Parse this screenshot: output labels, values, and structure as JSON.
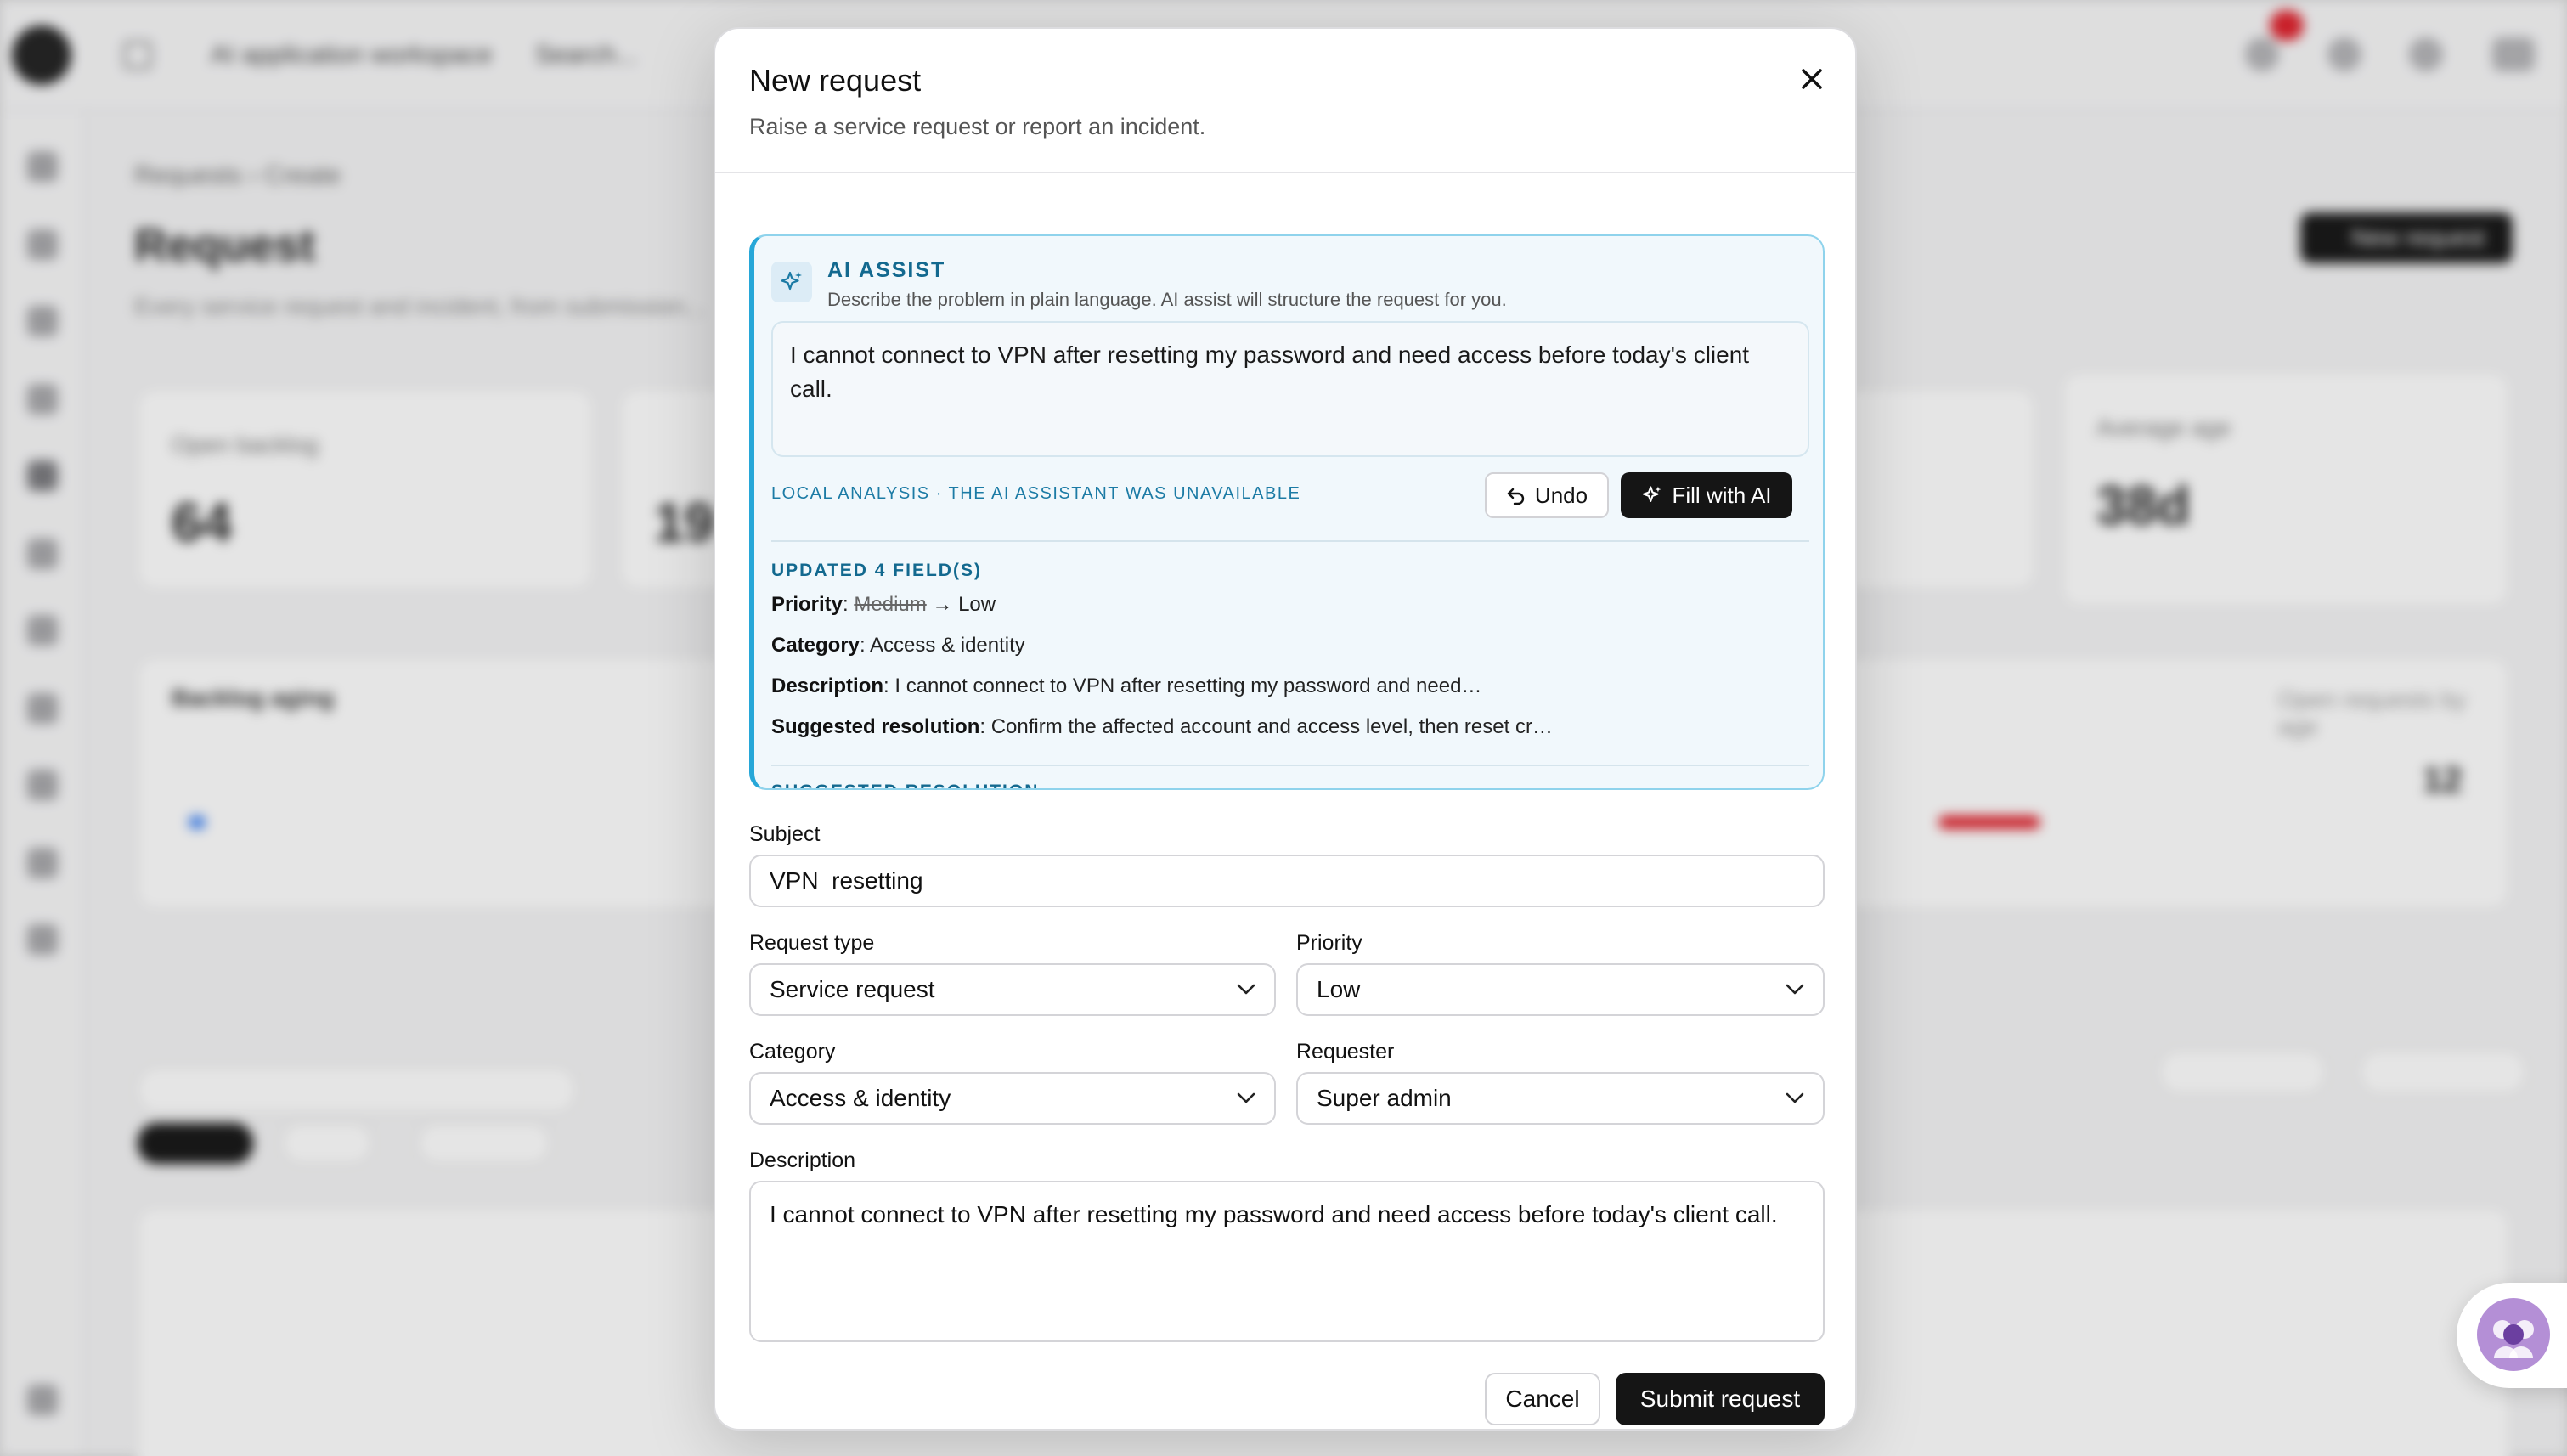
{
  "modal": {
    "title": "New request",
    "subtitle": "Raise a service request or report an incident."
  },
  "ai_assist": {
    "heading": "AI ASSIST",
    "description": "Describe the problem in plain language. AI assist will structure the request for you.",
    "prompt_value": "I cannot connect to VPN after resetting my password and need access before today's client call.",
    "status": "LOCAL ANALYSIS · THE AI ASSISTANT WAS UNAVAILABLE",
    "undo_label": "Undo",
    "fill_label": "Fill with AI",
    "updated_heading": "UPDATED 4 FIELD(S)",
    "changes": {
      "priority": {
        "label": "Priority",
        "old": "Medium",
        "new": "Low"
      },
      "category": {
        "label": "Category",
        "value": "Access & identity"
      },
      "description": {
        "label": "Description",
        "value": "I cannot connect to VPN after resetting my password and need…"
      },
      "resolution": {
        "label": "Suggested resolution",
        "value": "Confirm the affected account and access level, then reset cr…"
      }
    },
    "suggested_heading": "SUGGESTED RESOLUTION"
  },
  "form": {
    "subject": {
      "label": "Subject",
      "value": "VPN  resetting"
    },
    "request_type": {
      "label": "Request type",
      "value": "Service request"
    },
    "priority": {
      "label": "Priority",
      "value": "Low"
    },
    "category": {
      "label": "Category",
      "value": "Access & identity"
    },
    "requester": {
      "label": "Requester",
      "value": "Super admin"
    },
    "description": {
      "label": "Description",
      "value": "I cannot connect to VPN after resetting my password and need access before today's client call."
    },
    "cancel_label": "Cancel",
    "submit_label": "Submit request"
  },
  "background": {
    "workspace": "AI application workspace",
    "search": "Search...",
    "breadcrumb": "Requests  ›  Create",
    "page_title": "Request",
    "page_subtitle": "Every service request and incident, from submission...",
    "new_button": "New request",
    "stat_open_label": "Open backlog",
    "stat_open_value": "64",
    "stat_second_value": "19",
    "stat_age_label": "Average age",
    "stat_age_value": "38d",
    "aging_title": "Backlog aging",
    "aging_right": "Open requests by age",
    "aging_last_value": "12"
  },
  "colors": {
    "accent": "#27a7d8",
    "accent_text": "#13698f",
    "primary_button": "#151515",
    "ai_panel_bg": "#f1f8fc"
  }
}
